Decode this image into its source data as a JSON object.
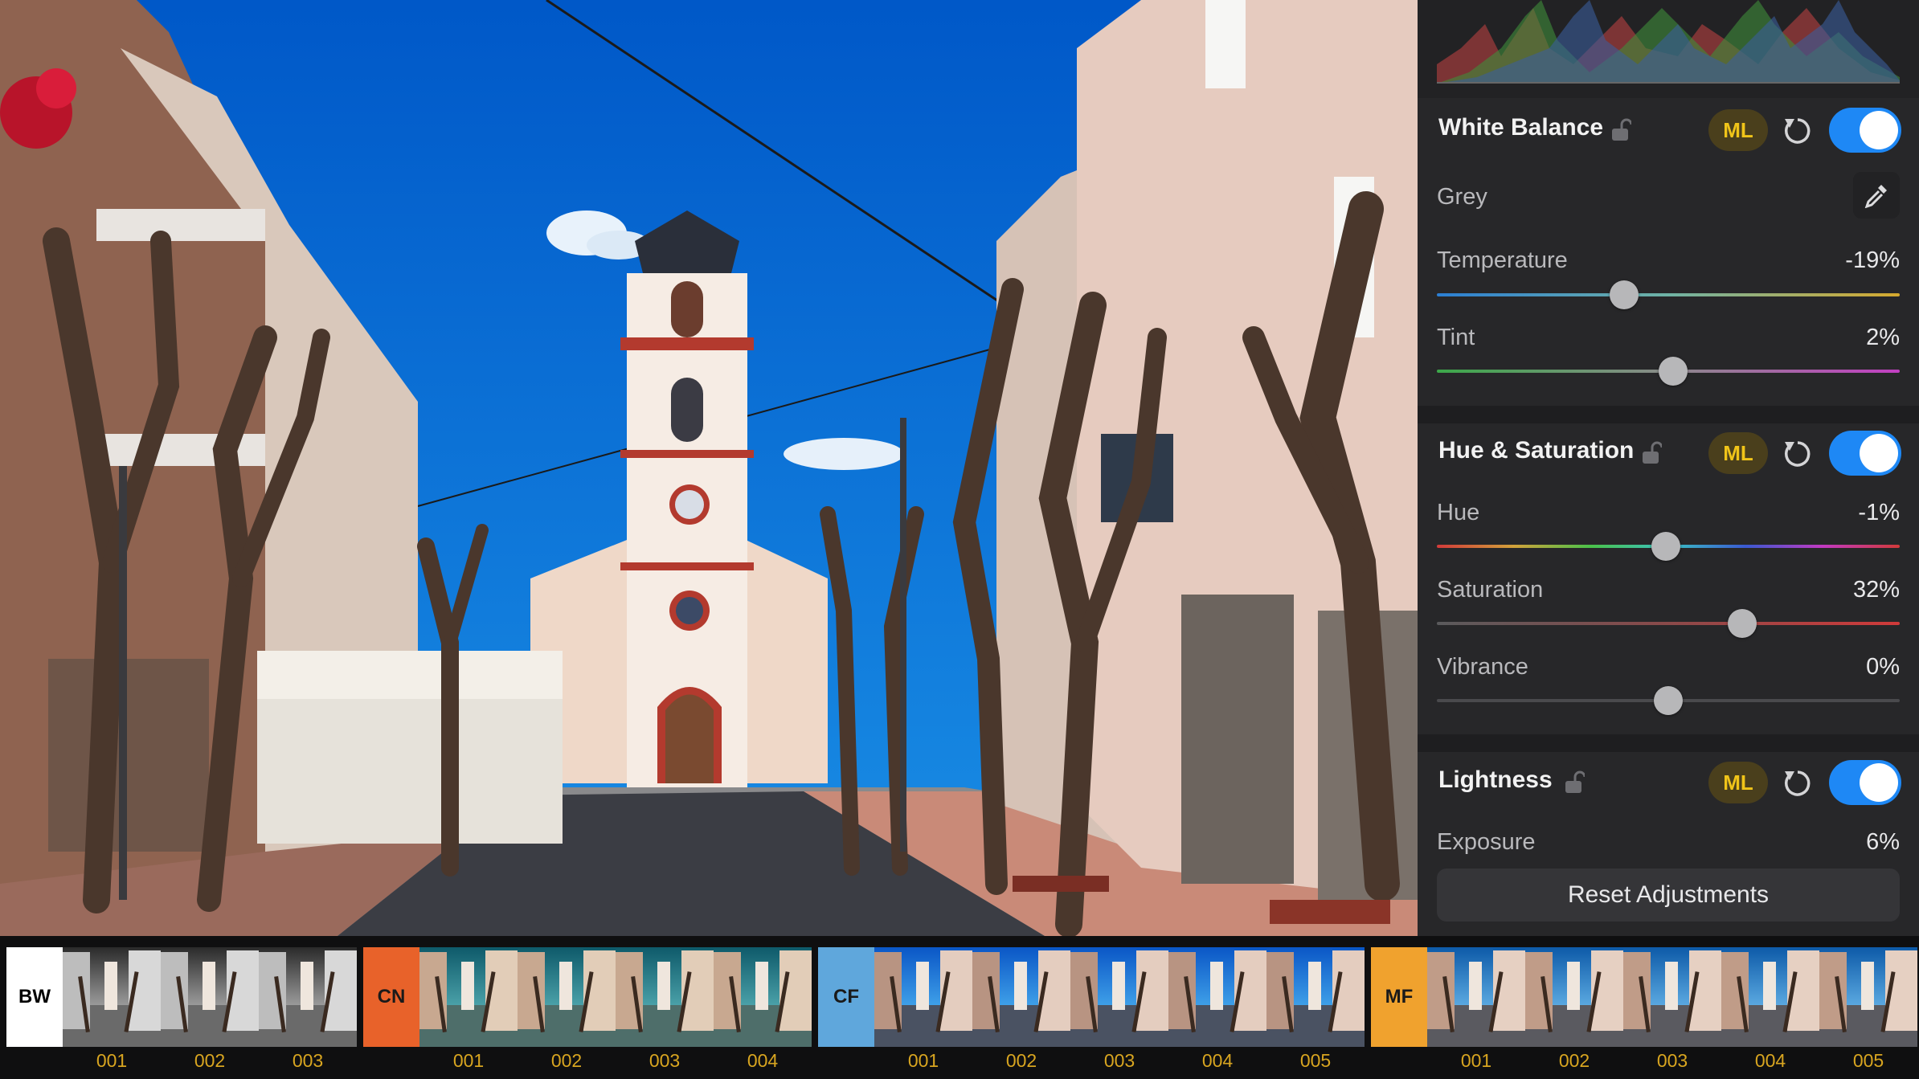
{
  "histogram": {
    "icon": "rgb-histogram"
  },
  "white_balance": {
    "title": "White Balance",
    "ml_label": "ML",
    "enabled": true,
    "grey_label": "Grey",
    "grey_icon": "eyedropper-icon",
    "temperature": {
      "label": "Temperature",
      "value": "-19%",
      "level": -0.19
    },
    "tint": {
      "label": "Tint",
      "value": "2%",
      "level": 0.02
    }
  },
  "hue_saturation": {
    "title": "Hue & Saturation",
    "ml_label": "ML",
    "enabled": true,
    "hue": {
      "label": "Hue",
      "value": "-1%",
      "level": -0.01
    },
    "saturation": {
      "label": "Saturation",
      "value": "32%",
      "level": 0.32
    },
    "vibrance": {
      "label": "Vibrance",
      "value": "0%",
      "level": 0.0
    }
  },
  "lightness": {
    "title": "Lightness",
    "ml_label": "ML",
    "enabled": true,
    "exposure": {
      "label": "Exposure",
      "value": "6%",
      "level": 0.06
    }
  },
  "reset_label": "Reset Adjustments",
  "filmstrip": {
    "groups": [
      {
        "badge": "BW",
        "badge_color": "#ffffff",
        "badge_text_color": "#000000",
        "style": "bw",
        "items": [
          "001",
          "002",
          "003"
        ]
      },
      {
        "badge": "CN",
        "badge_color": "#e8622a",
        "badge_text_color": "#1a1a1a",
        "style": "cn",
        "items": [
          "001",
          "002",
          "003",
          "004"
        ]
      },
      {
        "badge": "CF",
        "badge_color": "#5fa7dc",
        "badge_text_color": "#1a1a1a",
        "style": "cf",
        "items": [
          "001",
          "002",
          "003",
          "004",
          "005"
        ]
      },
      {
        "badge": "MF",
        "badge_color": "#f0a22e",
        "badge_text_color": "#1a1a1a",
        "style": "mf",
        "items": [
          "001",
          "002",
          "003",
          "004",
          "005"
        ]
      }
    ]
  },
  "colors": {
    "accent": "#1e88f5",
    "ml_badge_text": "#f0c419",
    "film_label": "#d8a520"
  }
}
